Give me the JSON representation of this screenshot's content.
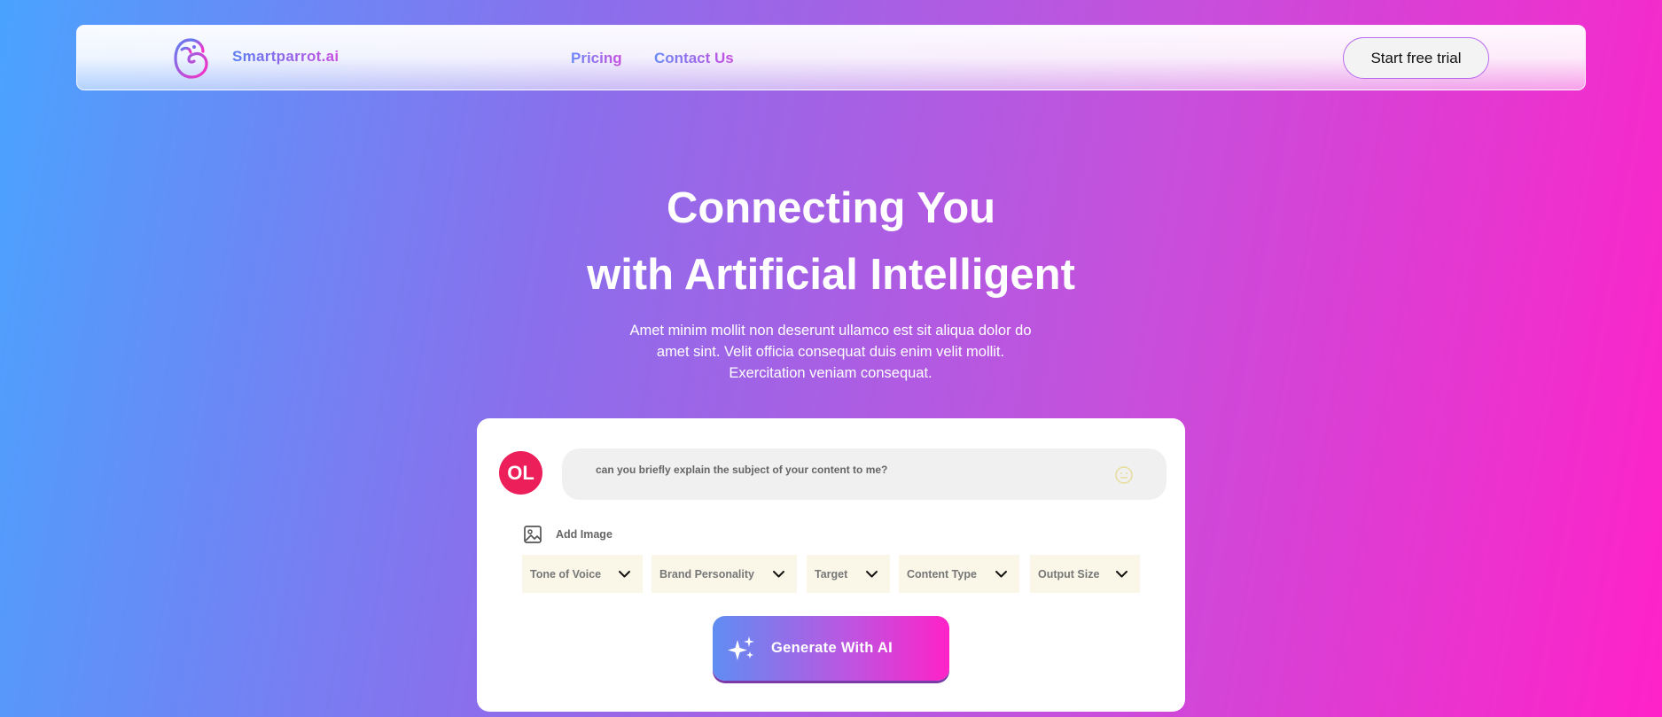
{
  "header": {
    "logo_text": "Smartparrot.ai",
    "nav": [
      {
        "label": "Pricing"
      },
      {
        "label": "Contact Us"
      }
    ],
    "cta_label": "Start free trial"
  },
  "hero": {
    "title_line1": "Connecting You",
    "title_line2": "with Artificial Intelligent",
    "description_line1": "Amet minim mollit non deserunt ullamco est sit aliqua dolor do",
    "description_line2": "amet sint. Velit officia consequat duis enim velit mollit.",
    "description_line3": "Exercitation veniam consequat."
  },
  "generator": {
    "avatar_initials": "OL",
    "prompt_text": "can you briefly explain the subject of your content to me?",
    "add_image_label": "Add Image",
    "dropdowns": [
      {
        "label": "Tone of Voice"
      },
      {
        "label": "Brand Personality"
      },
      {
        "label": "Target"
      },
      {
        "label": "Content Type"
      },
      {
        "label": "Output Size"
      }
    ],
    "generate_label": "Generate With AI"
  },
  "icons": {
    "logo": "parrot-logo-icon",
    "emoji": "smiley-icon",
    "image": "image-icon",
    "chevron": "chevron-down-icon",
    "sparkle": "sparkle-icon"
  },
  "colors": {
    "avatar": "#ec1f5a",
    "dropdown_bg": "#fbf7e8",
    "gradient_start": "#4aa3ff",
    "gradient_end": "#ff22c8"
  }
}
